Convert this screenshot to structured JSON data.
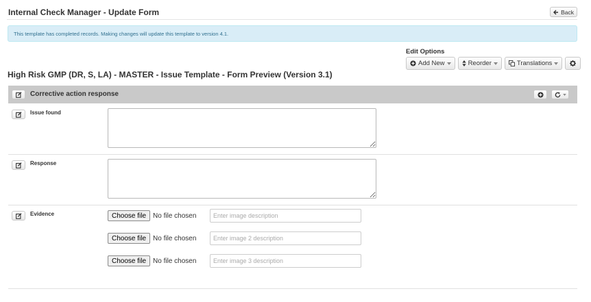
{
  "header": {
    "title": "Internal Check Manager - Update Form",
    "back_label": "Back"
  },
  "alert": {
    "message": "This template has completed records. Making changes will update this template to version 4.1."
  },
  "edit_options": {
    "label": "Edit Options",
    "add_new": "Add New",
    "reorder": "Reorder",
    "translations": "Translations"
  },
  "form": {
    "title": "High Risk GMP (DR, S, LA) - MASTER - Issue Template - Form Preview (Version 3.1)"
  },
  "section": {
    "title": "Corrective action response"
  },
  "fields": {
    "issue_found": {
      "label": "Issue found",
      "value": ""
    },
    "response": {
      "label": "Response",
      "value": ""
    },
    "evidence": {
      "label": "Evidence",
      "files": [
        {
          "button": "Choose file",
          "status": "No file chosen",
          "placeholder": "Enter image description"
        },
        {
          "button": "Choose file",
          "status": "No file chosen",
          "placeholder": "Enter image 2 description"
        },
        {
          "button": "Choose file",
          "status": "No file chosen",
          "placeholder": "Enter image 3 description"
        }
      ]
    }
  },
  "colors": {
    "alert_bg": "#d9edf7",
    "alert_text": "#31708f",
    "section_bg": "#c9c9c9"
  },
  "icons": {
    "back": "arrow-left-icon",
    "add": "plus-circle-icon",
    "reorder": "sort-icon",
    "translations": "language-icon",
    "settings": "gear-icon",
    "edit": "edit-icon",
    "refresh": "refresh-icon",
    "caret": "caret-down-icon"
  }
}
